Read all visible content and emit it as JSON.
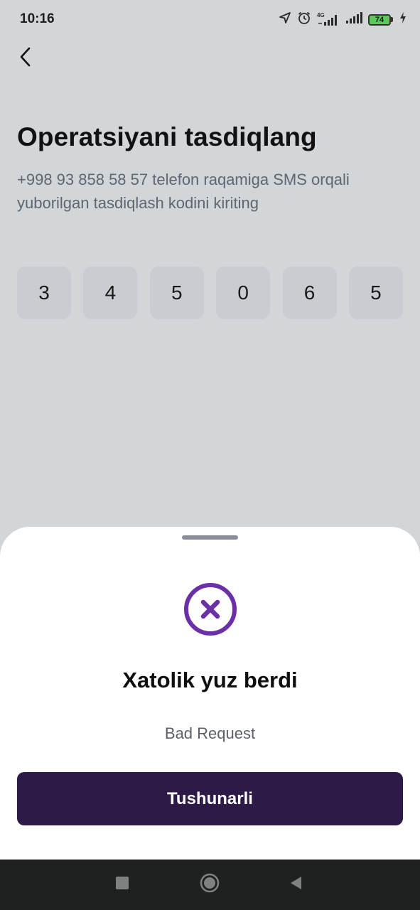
{
  "status_bar": {
    "time": "10:16",
    "network": "4G",
    "battery_level": "74",
    "icons": [
      "location-arrow-icon",
      "alarm-icon",
      "signal-4g-icon",
      "signal-icon",
      "battery-icon",
      "charging-icon"
    ]
  },
  "header": {
    "back_icon": "chevron-left-icon",
    "title": "Operatsiyani tasdiqlang",
    "subtitle": "+998 93 858 58 57 telefon raqamiga SMS orqali yuborilgan tasdiqlash kodini kiriting"
  },
  "code": {
    "digits": [
      "3",
      "4",
      "5",
      "0",
      "6",
      "5"
    ]
  },
  "sheet": {
    "icon": "error-x-circle-icon",
    "title": "Xatolik yuz berdi",
    "message": "Bad Request",
    "button_label": "Tushunarli"
  },
  "colors": {
    "background": "#d2d6d9",
    "code_cell": "#c9cdd1",
    "accent": "#6b2fa6",
    "button": "#2e1a47",
    "sheet": "#ffffff"
  },
  "nav_bar": {
    "icons": [
      "recent-apps-square-icon",
      "home-circle-icon",
      "back-triangle-icon"
    ]
  }
}
